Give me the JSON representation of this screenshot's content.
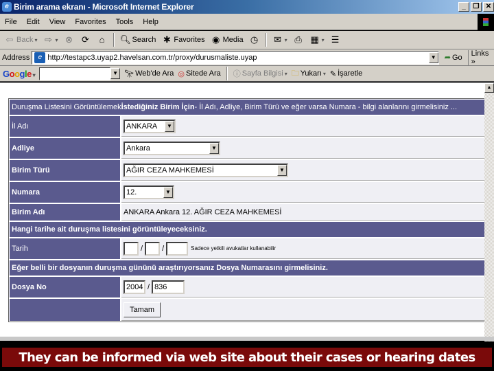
{
  "window": {
    "title": "Birim arama ekranı - Microsoft Internet Explorer",
    "controls": [
      "_",
      "❐",
      "✕"
    ]
  },
  "menu": [
    "File",
    "Edit",
    "View",
    "Favorites",
    "Tools",
    "Help"
  ],
  "toolbar": {
    "back": "Back",
    "forward": "",
    "search": "Search",
    "favorites": "Favorites",
    "media": "Media"
  },
  "address": {
    "label": "Address",
    "url": "http://testapc3.uyap2.havelsan.com.tr/proxy/durusmaliste.uyap",
    "go": "Go",
    "links": "Links »"
  },
  "google_bar": {
    "logo": "Google",
    "search_value": "",
    "web_search": "Web'de Ara",
    "site_search": "Sitede Ara",
    "page_info": "Sayfa Bilgisi",
    "up": "Yukarı",
    "highlight": "İşaretle"
  },
  "form": {
    "intro_plain_1": "Duruşma Listesini Görüntülemek ",
    "intro_bold_1": "İstediğiniz Birim İçin",
    "intro_plain_2": " - İl Adı, Adliye, Birim Türü ve eğer varsa Numara - bilgi alanlarını girmelisiniz ...",
    "fields": {
      "il_adi": {
        "label": "İl Adı",
        "value": "ANKARA"
      },
      "adliye": {
        "label": "Adliye",
        "value": "Ankara"
      },
      "birim_turu": {
        "label": "Birim Türü",
        "value": "AĞIR CEZA MAHKEMESİ"
      },
      "numara": {
        "label": "Numara",
        "value": "12."
      },
      "birim_adi": {
        "label": "Birim Adı",
        "value": "ANKARA Ankara 12. AĞIR CEZA MAHKEMESİ"
      }
    },
    "date_header": "Hangi tarihe ait duruşma listesini görüntüleyeceksiniz.",
    "tarih": {
      "label": "Tarih",
      "day": "",
      "month": "",
      "year": "",
      "separator": "/",
      "note": "Sadece yetkili avukatlar kullanabilir"
    },
    "file_header": "Eğer belli bir dosyanın duruşma gününü araştırıyorsanız Dosya Numarasını girmelisiniz.",
    "dosya_no": {
      "label": "Dosya No",
      "year": "2004",
      "separator": "/",
      "number": "836"
    },
    "submit": "Tamam"
  },
  "caption": "They can be  informed via web site about their cases or hearing dates"
}
